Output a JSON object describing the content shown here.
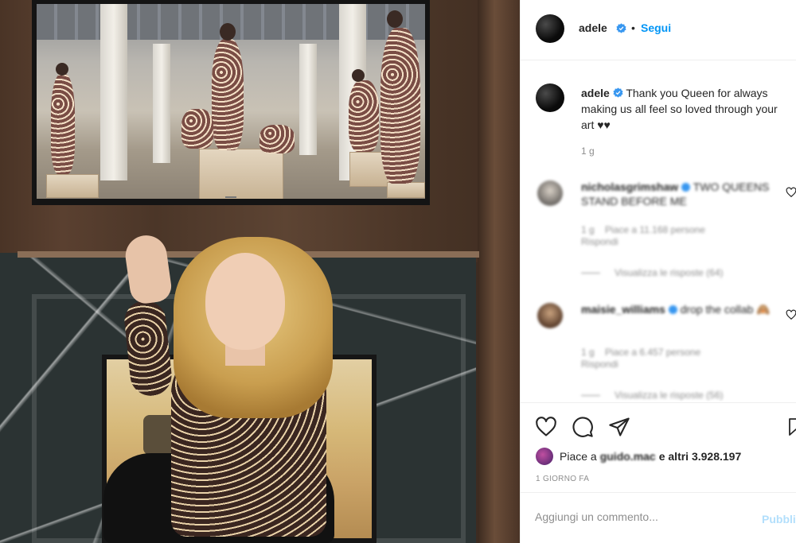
{
  "post": {
    "username": "adele",
    "follow_separator": "•",
    "follow_label": "Segui"
  },
  "caption": {
    "username": "adele",
    "text": "Thank you Queen for always making us all feel so loved through your art ♥♥",
    "age": "1 g"
  },
  "comments": [
    {
      "username": "nicholasgrimshaw",
      "text": "TWO QUEENS STAND BEFORE ME",
      "meta_age": "1 g",
      "meta_likes": "Piace a 11.168 persone",
      "reply_label": "Rispondi",
      "view_replies": "Visualizza le risposte (64)"
    },
    {
      "username": "maisie_williams",
      "text": "drop the collab 🙈",
      "meta_age": "1 g",
      "meta_likes": "Piace a 6.457 persone",
      "reply_label": "Rispondi",
      "view_replies": "Visualizza le risposte (56)"
    }
  ],
  "likes": {
    "prefix": "Piace a",
    "liker": "guido.mac",
    "suffix": "e altri 3.928.197"
  },
  "timestamp": "1 GIORNO FA",
  "add_comment": {
    "placeholder": "Aggiungi un commento...",
    "publish_label": "Pubblica"
  },
  "colors": {
    "accent": "#0095f6",
    "verified": "#3897f0",
    "publish_disabled": "#b2dffc",
    "secondary_text": "#8e8e8e"
  },
  "icons": {
    "verified": "verified-badge-icon",
    "like": "heart-icon",
    "comment": "comment-bubble-icon",
    "share": "paper-plane-icon",
    "save": "bookmark-icon"
  }
}
